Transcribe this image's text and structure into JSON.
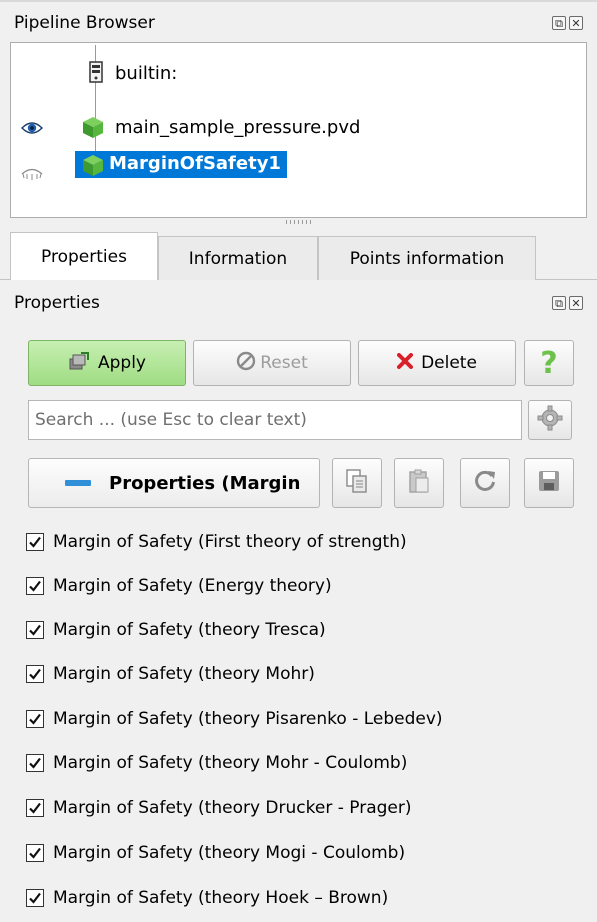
{
  "pipeline_browser": {
    "title": "Pipeline Browser",
    "items": [
      {
        "label": "builtin:",
        "icon": "server-icon",
        "visible": null
      },
      {
        "label": "main_sample_pressure.pvd",
        "icon": "green-cube-icon",
        "visible": true
      },
      {
        "label": "MarginOfSafety1",
        "icon": "green-cube-icon",
        "visible": false,
        "selected": true
      }
    ]
  },
  "tabs": [
    {
      "label": "Properties",
      "active": true
    },
    {
      "label": "Information",
      "active": false
    },
    {
      "label": "Points information",
      "active": false
    }
  ],
  "properties_panel": {
    "title": "Properties",
    "apply_label": "Apply",
    "reset_label": "Reset",
    "delete_label": "Delete",
    "help_label": "?",
    "search_placeholder": "Search ... (use Esc to clear text)",
    "section_title": "Properties (Margin"
  },
  "options": [
    {
      "label": "Margin of Safety (First theory of strength)",
      "checked": true
    },
    {
      "label": "Margin of Safety (Energy theory)",
      "checked": true
    },
    {
      "label": "Margin of Safety (theory Tresca)",
      "checked": true
    },
    {
      "label": "Margin of Safety (theory Mohr)",
      "checked": true
    },
    {
      "label": "Margin of Safety (theory Pisarenko - Lebedev)",
      "checked": true
    },
    {
      "label": "Margin of Safety (theory Mohr - Coulomb)",
      "checked": true
    },
    {
      "label": "Margin of Safety (theory Drucker - Prager)",
      "checked": true
    },
    {
      "label": "Margin of Safety (theory Mogi - Coulomb)",
      "checked": true
    },
    {
      "label": "Margin of Safety (theory Hoek – Brown)",
      "checked": true
    }
  ],
  "colors": {
    "selection": "#0078d7",
    "apply_green": "#9fdc83",
    "help_green": "#6cc24a",
    "delete_red": "#d9202a"
  }
}
